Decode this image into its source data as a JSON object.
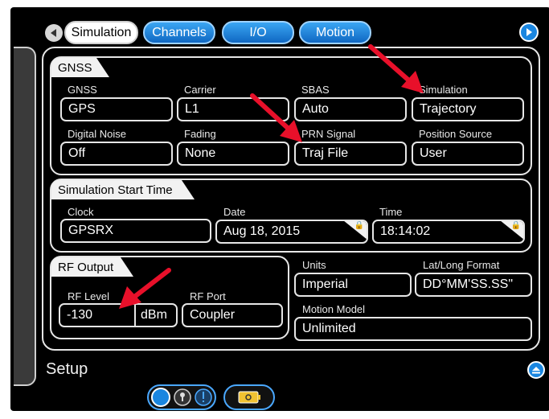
{
  "tabs": [
    {
      "label": "Simulation",
      "active": true
    },
    {
      "label": "Channels",
      "active": false
    },
    {
      "label": "I/O",
      "active": false
    },
    {
      "label": "Motion",
      "active": false
    }
  ],
  "gnss": {
    "title": "GNSS",
    "fields": [
      {
        "label": "GNSS",
        "value": "GPS"
      },
      {
        "label": "Carrier",
        "value": "L1"
      },
      {
        "label": "SBAS",
        "value": "Auto"
      },
      {
        "label": "Simulation",
        "value": "Trajectory"
      },
      {
        "label": "Digital Noise",
        "value": "Off"
      },
      {
        "label": "Fading",
        "value": "None"
      },
      {
        "label": "PRN Signal",
        "value": "Traj File"
      },
      {
        "label": "Position Source",
        "value": "User"
      }
    ]
  },
  "start_time": {
    "title": "Simulation Start Time",
    "clock": {
      "label": "Clock",
      "value": "GPSRX"
    },
    "date": {
      "label": "Date",
      "value": "Aug 18, 2015"
    },
    "time": {
      "label": "Time",
      "value": "18:14:02"
    }
  },
  "rf_output": {
    "title": "RF Output",
    "level": {
      "label": "RF Level",
      "value": "-130",
      "unit": "dBm"
    },
    "port": {
      "label": "RF Port",
      "value": "Coupler"
    }
  },
  "settings": {
    "units": {
      "label": "Units",
      "value": "Imperial"
    },
    "latlong": {
      "label": "Lat/Long Format",
      "value": "DD°MM'SS.SS\""
    },
    "motion_model": {
      "label": "Motion Model",
      "value": "Unlimited"
    }
  },
  "footer": {
    "setup_label": "Setup"
  },
  "colors": {
    "accent": "#1a86e0",
    "annotation_arrow": "#e8102a"
  },
  "icons": [
    "back-arrow-icon",
    "forward-arrow-icon",
    "lock-icon",
    "eject-up-icon",
    "key-icon",
    "info-icon",
    "battery-icon"
  ]
}
